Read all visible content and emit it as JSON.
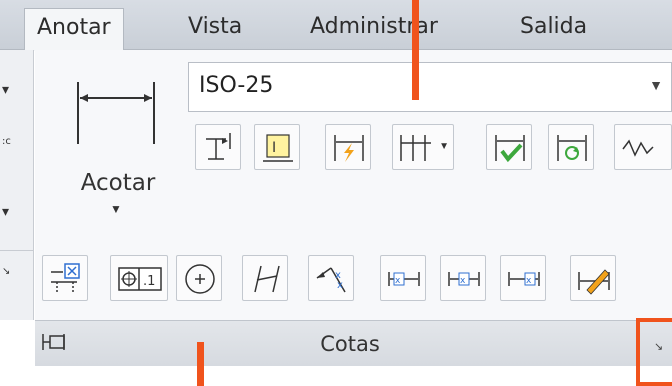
{
  "tabs": [
    {
      "label": "Anotar",
      "active": true
    },
    {
      "label": "Vista",
      "active": false
    },
    {
      "label": "Administrar",
      "active": false
    },
    {
      "label": "Salida",
      "active": false
    }
  ],
  "dimension": {
    "big_button_label": "Acotar",
    "style_dropdown_value": "ISO-25",
    "row1_tools": [
      "baseline-icon",
      "oblique-text-icon",
      "break-icon",
      "continue-dimension-icon",
      "inspect-icon",
      "update-icon",
      "jogged-linear-icon"
    ],
    "row2_tools": [
      "tolerance-icon",
      "datum-icon",
      "center-mark-icon",
      "oblique-icon",
      "jogged-icon",
      "text-left-icon",
      "text-center-icon",
      "text-right-icon",
      "edit-text-icon"
    ]
  },
  "panel": {
    "title": "Cotas"
  },
  "colors": {
    "annotation": "#f0531c",
    "accent_green": "#3da83d",
    "accent_blue": "#2f6fd1"
  }
}
